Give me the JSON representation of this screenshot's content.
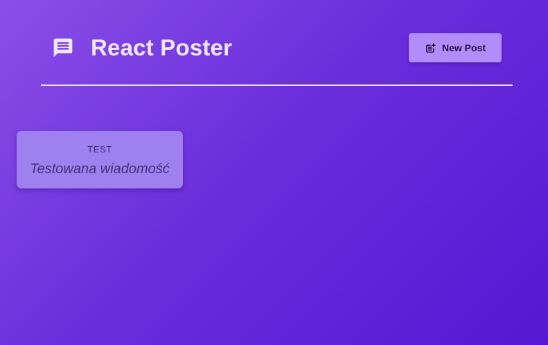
{
  "header": {
    "logo_icon": "message-icon",
    "title": "React Poster",
    "new_post": {
      "icon": "post-add-icon",
      "label": "New Post"
    }
  },
  "posts": [
    {
      "author": "TEST",
      "body": "Testowana wiadomość"
    }
  ],
  "colors": {
    "background_start": "#8a4fe6",
    "background_end": "#5617d4",
    "title": "#efe6ff",
    "button": "#b28cfb",
    "card": "#9e80ee"
  }
}
